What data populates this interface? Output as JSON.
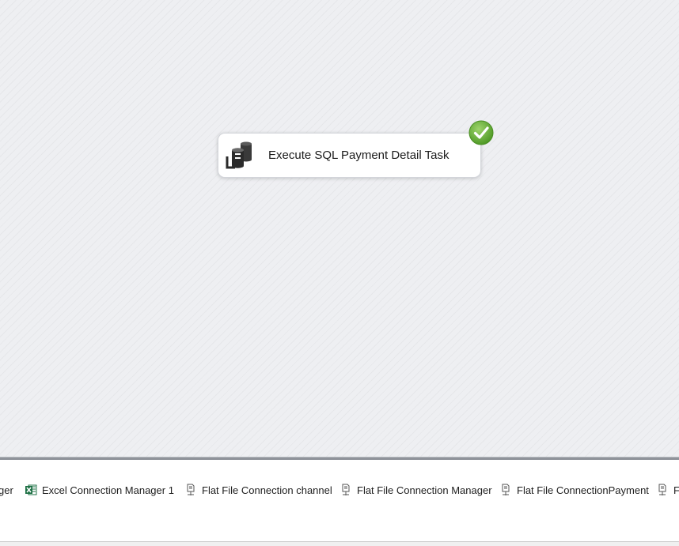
{
  "canvas": {
    "task": {
      "label": "Execute SQL Payment Detail Task",
      "icon": "execute-sql-task-icon",
      "status": "success"
    }
  },
  "connection_managers": {
    "items": [
      {
        "label": "ger",
        "icon": "connection-manager-icon"
      },
      {
        "label": "Excel Connection Manager 1",
        "icon": "excel-icon"
      },
      {
        "label": "Flat File Connection channel",
        "icon": "flat-file-icon"
      },
      {
        "label": "Flat File Connection Manager",
        "icon": "flat-file-icon"
      },
      {
        "label": "Flat File ConnectionPayment",
        "icon": "flat-file-icon"
      },
      {
        "label": "Fl",
        "icon": "flat-file-icon"
      }
    ]
  },
  "colors": {
    "success": "#6cb33f",
    "canvas_bg": "#eeeff2",
    "excel_green": "#1e7145"
  }
}
